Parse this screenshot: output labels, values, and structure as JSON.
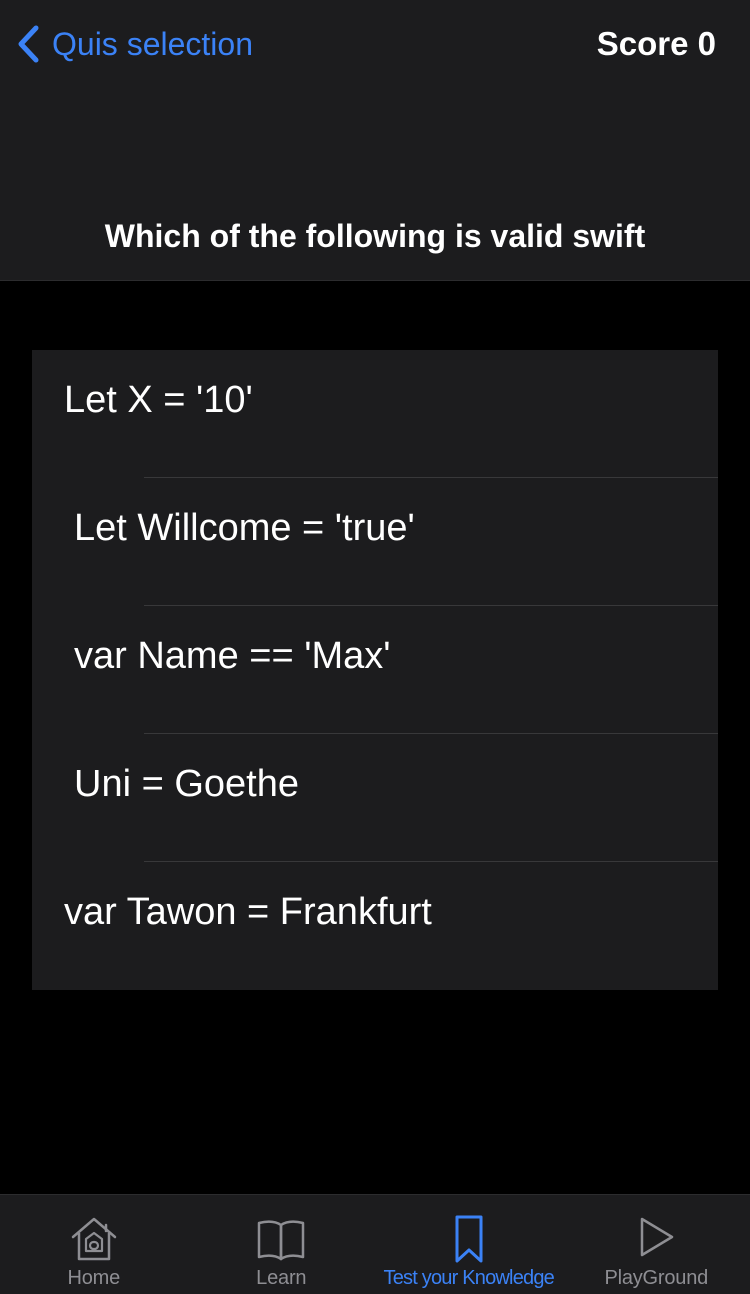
{
  "nav": {
    "back_label": "Quis selection",
    "score_label": "Score 0"
  },
  "question": {
    "text": "Which of the following is valid swift"
  },
  "answers": [
    {
      "label": "Let X = '10'"
    },
    {
      "label": "Let Willcome = 'true'"
    },
    {
      "label": "var Name == 'Max'"
    },
    {
      "label": "Uni = Goethe"
    },
    {
      "label": "var Tawon = Frankfurt"
    }
  ],
  "tabbar": {
    "tabs": [
      {
        "label": "Home",
        "icon": "house-icon",
        "active": false
      },
      {
        "label": "Learn",
        "icon": "book-icon",
        "active": false
      },
      {
        "label": "Test your Knowledge",
        "icon": "bookmark-icon",
        "active": true
      },
      {
        "label": "PlayGround",
        "icon": "play-icon",
        "active": false
      }
    ]
  },
  "colors": {
    "accent": "#3b82f6",
    "background": "#000000",
    "surface": "#1c1c1e",
    "inactive": "#8e8e93"
  }
}
